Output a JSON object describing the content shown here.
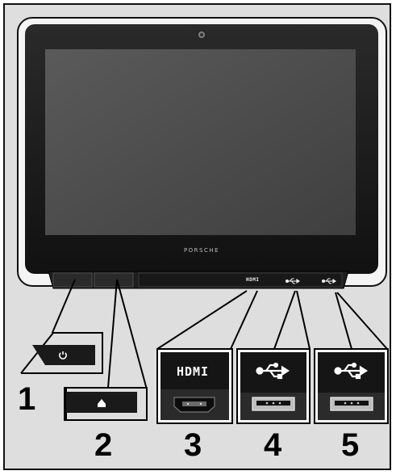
{
  "device": {
    "brand_text": "PORSCHE",
    "port_labels": {
      "hdmi_small": "HDMI",
      "hdmi_large": "HDMI"
    }
  },
  "callouts": [
    {
      "number": "1",
      "item": "power-button"
    },
    {
      "number": "2",
      "item": "home-button"
    },
    {
      "number": "3",
      "item": "hdmi-port"
    },
    {
      "number": "4",
      "item": "usb-port-1"
    },
    {
      "number": "5",
      "item": "usb-port-2"
    }
  ],
  "icons": {
    "power": "power-icon",
    "home": "home-icon",
    "usb": "usb-icon"
  },
  "colors": {
    "background": "#dedede",
    "bezel": "#1a1a1a",
    "screen": "#4a4a4a",
    "frame": "#bfbfbf"
  }
}
